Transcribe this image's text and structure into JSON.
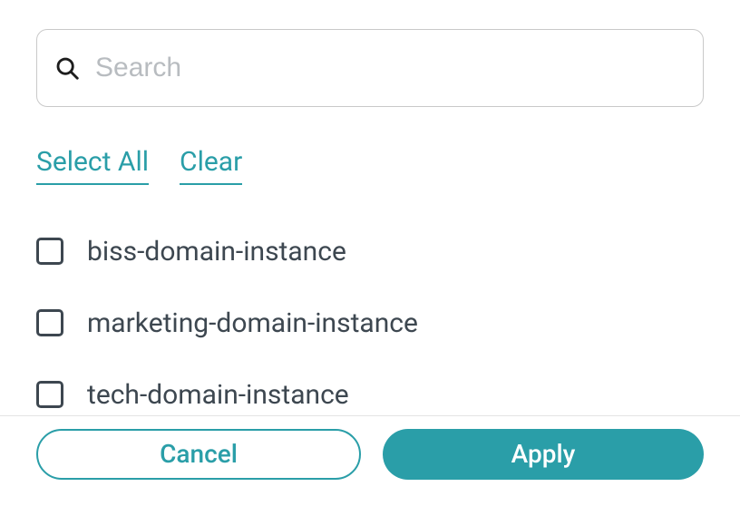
{
  "search": {
    "placeholder": "Search",
    "value": ""
  },
  "actions": {
    "select_all_label": "Select All",
    "clear_label": "Clear"
  },
  "items": [
    {
      "label": "biss-domain-instance",
      "checked": false
    },
    {
      "label": "marketing-domain-instance",
      "checked": false
    },
    {
      "label": "tech-domain-instance",
      "checked": false
    }
  ],
  "footer": {
    "cancel_label": "Cancel",
    "apply_label": "Apply"
  },
  "colors": {
    "accent": "#2a9ea8",
    "text": "#3d4750",
    "placeholder": "#b8bcc0",
    "border": "#c9c9c9",
    "divider": "#e3e3e3"
  }
}
